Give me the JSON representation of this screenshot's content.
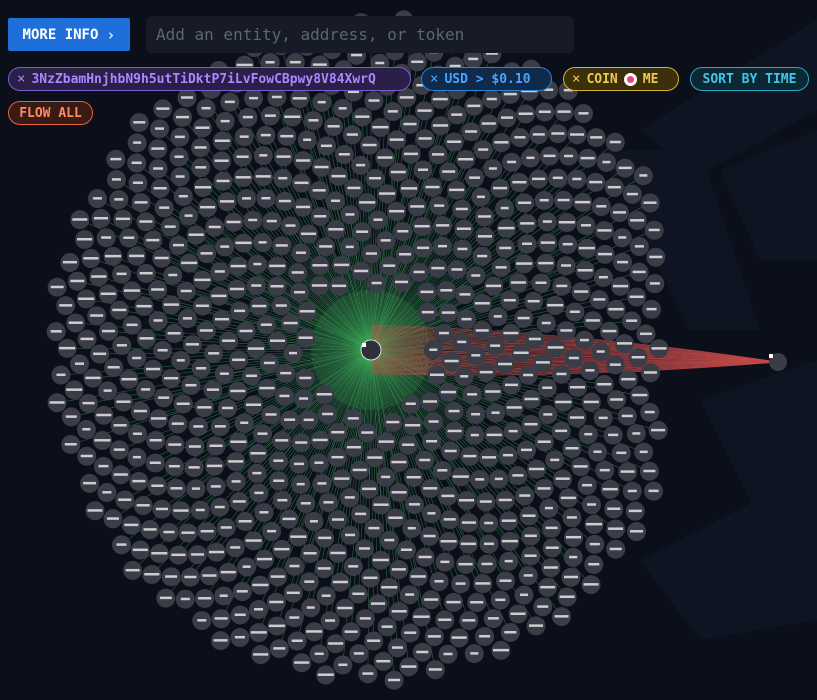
{
  "toolbar": {
    "more_info_label": "MORE INFO",
    "search_placeholder": "Add an entity, address, or token"
  },
  "filters": {
    "address": "3NzZbamHnjhbN9h5utTiDktP7iLvFowCBpwy8V84XwrQ",
    "usd": "USD > $0.10",
    "coin_prefix": "COIN",
    "coin_suffix": "ME",
    "sort": "SORT BY TIME",
    "flow": "FLOW ALL"
  },
  "colors": {
    "background": "#0b0f19",
    "node_fill": "#3a3d47",
    "inflow_edge": "#3fae5b",
    "outflow_edge": "#c24a4a",
    "accent_blue": "#1e6fd9"
  },
  "icons": {
    "close": "close-icon",
    "chevron": "chevron-right-icon",
    "coin": "coin-logo-icon"
  }
}
